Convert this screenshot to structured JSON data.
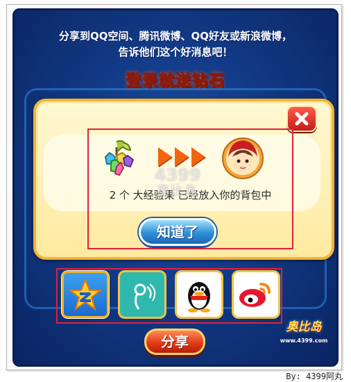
{
  "header": {
    "line1": "分享到QQ空间、腾讯微博、QQ好友或新浪微博，",
    "line2": "告诉他们这个好消息吧！",
    "title": "登录就送钻石"
  },
  "dialog": {
    "reward_text": "2 个  大经验果  已经放入你的背包中",
    "ok_label": "知道了",
    "watermark_line1": "4399",
    "watermark_line2": "奥比岛"
  },
  "share": {
    "icons": [
      "qzone-icon",
      "tencent-weibo-icon",
      "qq-penguin-icon",
      "sina-weibo-icon"
    ],
    "button_label": "分享"
  },
  "logo": {
    "text": "奥比岛",
    "sub": "www.4399.com"
  },
  "credit": "By: 4399阿丸",
  "colors": {
    "background": "#123a86",
    "dialog": "#ffeaa0",
    "highlight_box": "#e0203a",
    "ok_button": "#2f8fd6",
    "share_button": "#e03612"
  }
}
